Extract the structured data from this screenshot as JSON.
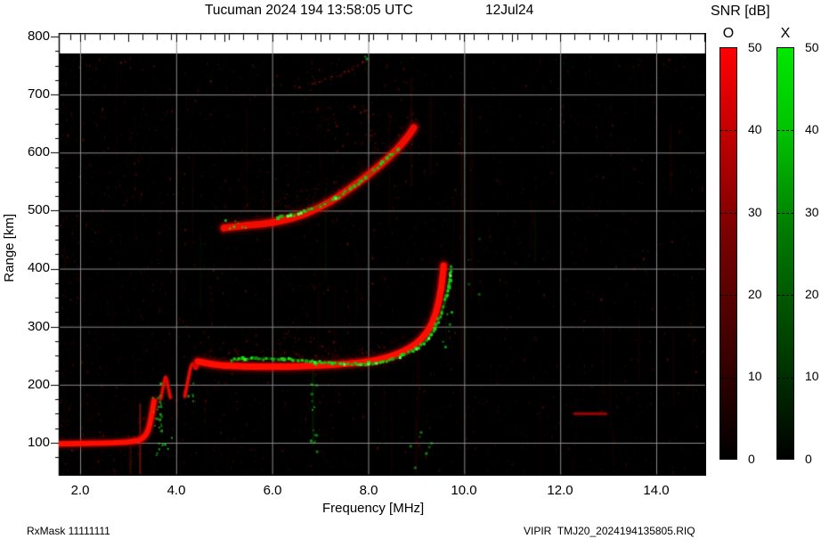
{
  "header": {
    "title": "Tucuman 2024 194 13:58:05 UTC",
    "date": "12Jul24"
  },
  "colorbar": {
    "title": "SNR [dB]",
    "o_label": "O",
    "x_label": "X",
    "min": 0,
    "max": 50,
    "ticks": [
      "50",
      "40",
      "30",
      "20",
      "10",
      "0"
    ],
    "o_top_color": "#ff0000",
    "x_top_color": "#00e800"
  },
  "axes": {
    "x": {
      "label": "Frequency [MHz]",
      "ticks": [
        "2.0",
        "4.0",
        "6.0",
        "8.0",
        "10.0",
        "12.0",
        "14.0"
      ],
      "lim": [
        1.55,
        15.05
      ]
    },
    "y": {
      "label": "Range [km]",
      "ticks": [
        "800",
        "700",
        "600",
        "500",
        "400",
        "300",
        "200",
        "100"
      ],
      "lim": [
        43,
        806
      ]
    }
  },
  "footer": {
    "left": "RxMask 11111111",
    "right": "VIPIR  TMJ20_2024194135805.RIQ"
  },
  "chart_data": {
    "type": "heatmap",
    "description": "VIPIR ionogram: echo SNR (0-50 dB) vs sounding frequency and virtual range. O-mode echoes red, X-mode echoes green on black background.",
    "title": "Tucuman 2024 194 13:58:05 UTC",
    "xlabel": "Frequency [MHz]",
    "ylabel": "Range [km]",
    "xlim": [
      1.55,
      15.05
    ],
    "ylim": [
      43,
      806
    ],
    "snr_range_db": [
      0,
      50
    ],
    "grid": {
      "x_major": [
        2,
        4,
        6,
        8,
        10,
        12,
        14
      ],
      "y_major": [
        100,
        200,
        300,
        400,
        500,
        600,
        700
      ],
      "color": "#8a8a8a"
    },
    "traces": [
      {
        "id": "E-region-O",
        "mode": "O",
        "style": "band",
        "w_km": 9,
        "alpha": 1.0,
        "fuzz_km": 8,
        "points": [
          [
            1.55,
            98
          ],
          [
            2.2,
            99
          ],
          [
            2.8,
            100
          ],
          [
            3.1,
            102
          ],
          [
            3.3,
            106
          ],
          [
            3.42,
            120
          ],
          [
            3.5,
            152
          ],
          [
            3.54,
            172
          ]
        ]
      },
      {
        "id": "Es-cusp1-O",
        "mode": "O",
        "style": "band",
        "w_km": 5,
        "alpha": 0.8,
        "fuzz_km": 0,
        "points": [
          [
            3.68,
            176
          ],
          [
            3.74,
            200
          ],
          [
            3.78,
            218
          ],
          [
            3.83,
            196
          ],
          [
            3.88,
            178
          ]
        ]
      },
      {
        "id": "Es-cusp2-O",
        "mode": "O",
        "style": "band",
        "w_km": 5,
        "alpha": 0.85,
        "fuzz_km": 0,
        "points": [
          [
            4.18,
            180
          ],
          [
            4.26,
            214
          ],
          [
            4.33,
            241
          ],
          [
            4.41,
            224
          ],
          [
            4.45,
            238
          ]
        ]
      },
      {
        "id": "F-trace-O",
        "mode": "O",
        "style": "band",
        "w_km": 11,
        "alpha": 1.0,
        "fuzz_km": 26,
        "points": [
          [
            4.45,
            240
          ],
          [
            4.8,
            234
          ],
          [
            5.2,
            232
          ],
          [
            5.7,
            231
          ],
          [
            6.2,
            231
          ],
          [
            6.7,
            232
          ],
          [
            7.2,
            234
          ],
          [
            7.7,
            237
          ],
          [
            8.1,
            241
          ],
          [
            8.45,
            248
          ],
          [
            8.75,
            258
          ],
          [
            9.0,
            270
          ],
          [
            9.2,
            287
          ],
          [
            9.35,
            308
          ],
          [
            9.45,
            335
          ],
          [
            9.52,
            365
          ],
          [
            9.56,
            393
          ],
          [
            9.57,
            405
          ]
        ]
      },
      {
        "id": "F-trace-X",
        "mode": "X",
        "style": "blocks",
        "w_km": 7,
        "alpha": 1.0,
        "gap": 0.1,
        "points": [
          [
            5.15,
            243
          ],
          [
            5.6,
            245
          ],
          [
            6.0,
            245
          ],
          [
            6.45,
            243
          ],
          [
            6.9,
            239
          ],
          [
            7.3,
            236
          ],
          [
            7.7,
            235
          ],
          [
            8.05,
            236
          ],
          [
            8.35,
            240
          ],
          [
            8.65,
            247
          ],
          [
            8.95,
            259
          ],
          [
            9.2,
            274
          ],
          [
            9.4,
            297
          ],
          [
            9.55,
            327
          ],
          [
            9.65,
            360
          ],
          [
            9.71,
            390
          ],
          [
            9.73,
            402
          ]
        ]
      },
      {
        "id": "2F-trace-O",
        "mode": "O",
        "style": "band",
        "w_km": 12,
        "alpha": 0.9,
        "fuzz_km": 40,
        "points": [
          [
            5.0,
            470
          ],
          [
            5.4,
            474
          ],
          [
            5.8,
            477
          ],
          [
            6.2,
            482
          ],
          [
            6.55,
            490
          ],
          [
            6.9,
            502
          ],
          [
            7.2,
            515
          ],
          [
            7.5,
            531
          ],
          [
            7.8,
            549
          ],
          [
            8.1,
            568
          ],
          [
            8.4,
            589
          ],
          [
            8.65,
            610
          ],
          [
            8.85,
            630
          ],
          [
            8.95,
            643
          ]
        ]
      },
      {
        "id": "2F-trace-X",
        "mode": "X",
        "style": "blocks",
        "w_km": 7,
        "alpha": 0.9,
        "gap": 0.3,
        "points": [
          [
            6.1,
            488
          ],
          [
            6.5,
            494
          ],
          [
            6.9,
            504
          ],
          [
            7.25,
            518
          ],
          [
            7.55,
            533
          ],
          [
            7.85,
            551
          ],
          [
            8.15,
            571
          ],
          [
            8.45,
            593
          ],
          [
            8.6,
            604
          ]
        ]
      },
      {
        "id": "3F-trace-O",
        "mode": "O",
        "style": "dots",
        "w_km": 5,
        "alpha": 0.5,
        "fuzz_km": 10,
        "points": [
          [
            6.45,
            714
          ],
          [
            6.8,
            720
          ],
          [
            7.2,
            730
          ],
          [
            7.6,
            744
          ],
          [
            7.95,
            760
          ]
        ]
      },
      {
        "id": "interference-dash-O",
        "mode": "O",
        "style": "band",
        "w_km": 4,
        "alpha": 0.5,
        "fuzz_km": 0,
        "points": [
          [
            12.3,
            150
          ],
          [
            12.95,
            150
          ]
        ]
      }
    ],
    "clusters": [
      {
        "f": 3.6,
        "r": 140,
        "n": 24,
        "sf": 0.12,
        "sr": 75,
        "mode": "X",
        "a": 0.8
      },
      {
        "f": 3.75,
        "r": 100,
        "n": 7,
        "sf": 0.2,
        "sr": 10,
        "mode": "X",
        "a": 0.8
      },
      {
        "f": 4.3,
        "r": 190,
        "n": 5,
        "sf": 0.08,
        "sr": 22,
        "mode": "X",
        "a": 0.7
      },
      {
        "f": 6.85,
        "r": 170,
        "n": 13,
        "sf": 0.07,
        "sr": 72,
        "mode": "X",
        "a": 0.7
      },
      {
        "f": 6.9,
        "r": 100,
        "n": 3,
        "sf": 0.05,
        "sr": 18,
        "mode": "X",
        "a": 0.6
      },
      {
        "f": 9.1,
        "r": 80,
        "n": 8,
        "sf": 0.3,
        "sr": 45,
        "mode": "X",
        "a": 0.6
      },
      {
        "f": 9.62,
        "r": 300,
        "n": 6,
        "sf": 0.1,
        "sr": 40,
        "mode": "X",
        "a": 0.7
      },
      {
        "f": 7.9,
        "r": 764,
        "n": 2,
        "sf": 0.05,
        "sr": 6,
        "mode": "X",
        "a": 0.9
      },
      {
        "f": 5.2,
        "r": 478,
        "n": 8,
        "sf": 0.25,
        "sr": 12,
        "mode": "X",
        "a": 0.8
      },
      {
        "f": 10.2,
        "r": 400,
        "n": 4,
        "sf": 0.15,
        "sr": 90,
        "mode": "X",
        "a": 0.4
      },
      {
        "f": 7.6,
        "r": 635,
        "n": 36,
        "sf": 0.75,
        "sr": 55,
        "mode": "O",
        "a": 0.3
      },
      {
        "f": 8.35,
        "r": 700,
        "n": 10,
        "sf": 0.45,
        "sr": 55,
        "mode": "O",
        "a": 0.25
      },
      {
        "f": 6.3,
        "r": 272,
        "n": 30,
        "sf": 1.1,
        "sr": 22,
        "mode": "O",
        "a": 0.3
      },
      {
        "f": 4.9,
        "r": 210,
        "n": 10,
        "sf": 0.35,
        "sr": 40,
        "mode": "O",
        "a": 0.25
      }
    ],
    "streaks": [
      {
        "f": 3.25,
        "r0": 40,
        "r1": 168,
        "a": 0.45,
        "mode": "O"
      },
      {
        "f": 3.05,
        "r0": 45,
        "r1": 95,
        "a": 0.22,
        "mode": "O"
      },
      {
        "f": 4.02,
        "r0": 140,
        "r1": 205,
        "a": 0.18,
        "mode": "O"
      },
      {
        "f": 9.95,
        "r0": 240,
        "r1": 700,
        "a": 0.1,
        "mode": "O"
      },
      {
        "f": 10.15,
        "r0": 350,
        "r1": 680,
        "a": 0.08,
        "mode": "O"
      },
      {
        "f": 8.9,
        "r0": 540,
        "r1": 730,
        "a": 0.1,
        "mode": "O"
      },
      {
        "f": 9.3,
        "r0": 560,
        "r1": 700,
        "a": 0.08,
        "mode": "O"
      },
      {
        "f": 14.3,
        "r0": 530,
        "r1": 650,
        "a": 0.08,
        "mode": "O"
      },
      {
        "f": 11.4,
        "r0": 430,
        "r1": 520,
        "a": 0.06,
        "mode": "O"
      },
      {
        "f": 6.85,
        "r0": 95,
        "r1": 235,
        "a": 0.12,
        "mode": "X"
      },
      {
        "f": 9.0,
        "r0": 45,
        "r1": 140,
        "a": 0.1,
        "mode": "O"
      },
      {
        "f": 13.1,
        "r0": 60,
        "r1": 125,
        "a": 0.06,
        "mode": "O"
      }
    ],
    "noise": {
      "seed": 7,
      "red_speckles": 3400,
      "green_speckles": 520,
      "faint_streaks": 95
    }
  }
}
